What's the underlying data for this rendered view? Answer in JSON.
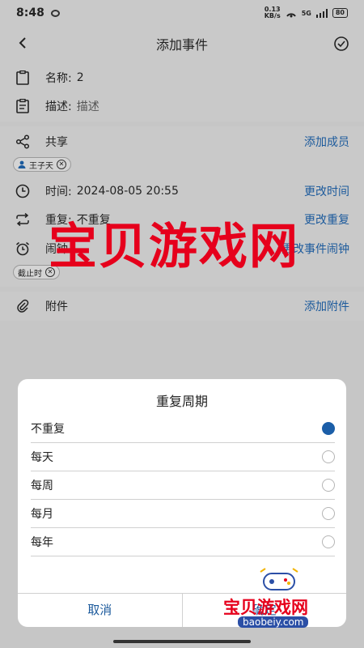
{
  "status": {
    "time": "8:48",
    "speed_top": "0.13",
    "speed_bottom": "KB/s",
    "network": "5G",
    "battery": "80"
  },
  "header": {
    "title": "添加事件"
  },
  "fields": {
    "name_label": "名称:",
    "name_value": "2",
    "desc_label": "描述:",
    "desc_placeholder": "描述",
    "share_label": "共享",
    "share_action": "添加成员",
    "member_chip": "王子天",
    "time_label": "时间:",
    "time_value": "2024-08-05 20:55",
    "time_action": "更改时间",
    "repeat_label": "重复:",
    "repeat_value": "不重复",
    "repeat_action": "更改重复",
    "alarm_label": "闹钟",
    "alarm_action": "更改事件闹钟",
    "alarm_chip": "截止时",
    "attach_label": "附件",
    "attach_action": "添加附件"
  },
  "dialog": {
    "title": "重复周期",
    "options": [
      {
        "label": "不重复",
        "selected": true
      },
      {
        "label": "每天",
        "selected": false
      },
      {
        "label": "每周",
        "selected": false
      },
      {
        "label": "每月",
        "selected": false
      },
      {
        "label": "每年",
        "selected": false
      }
    ],
    "cancel": "取消",
    "confirm": "确定"
  },
  "watermark": {
    "main": "宝贝游戏网",
    "small": "宝贝游戏网",
    "url": "baobeiy.com"
  },
  "colors": {
    "accent": "#1c5a9c",
    "radio_on": "#1b5ea8",
    "watermark": "#e6001c"
  }
}
